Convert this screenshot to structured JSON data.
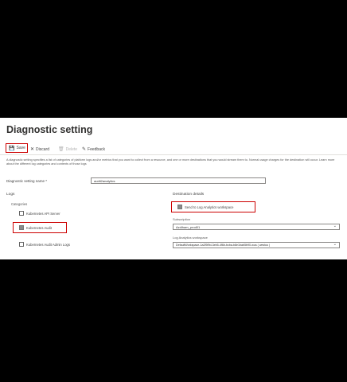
{
  "page": {
    "title": "Diagnostic setting"
  },
  "toolbar": {
    "save_label": "Save",
    "discard_label": "Discard",
    "delete_label": "Delete",
    "feedback_label": "Feedback"
  },
  "description": "A diagnostic setting specifies a list of categories of platform logs and/or metrics that you want to collect from a resource, and one or more destinations that you would stream them to. Normal usage charges for the destination will occur. Learn more about the different log categories and contents of those logs",
  "name_field": {
    "label": "Diagnostic setting name *",
    "value": "audit2analytics"
  },
  "logs": {
    "heading": "Logs",
    "categories_heading": "Categories",
    "categories": [
      {
        "label": "Kubernetes API Server",
        "checked": false
      },
      {
        "label": "Kubernetes Audit",
        "checked": true
      },
      {
        "label": "Kubernetes Audit Admin Logs",
        "checked": false
      }
    ]
  },
  "destination": {
    "heading": "Destination details",
    "send_to_la_label": "Send to Log Analytics workspace",
    "subscription_label": "Subscription",
    "subscription_value": "Azdiham_prod01",
    "workspace_label": "Log Analytics workspace",
    "workspace_value": "DefaultWorkspace-1a2f5f9d-3eb5-4f6b-bcba-b8e1bab5b90-wus ( westus )"
  },
  "colors": {
    "highlight": "#cc0000",
    "accent": "#0078d4",
    "background": "#000000"
  }
}
